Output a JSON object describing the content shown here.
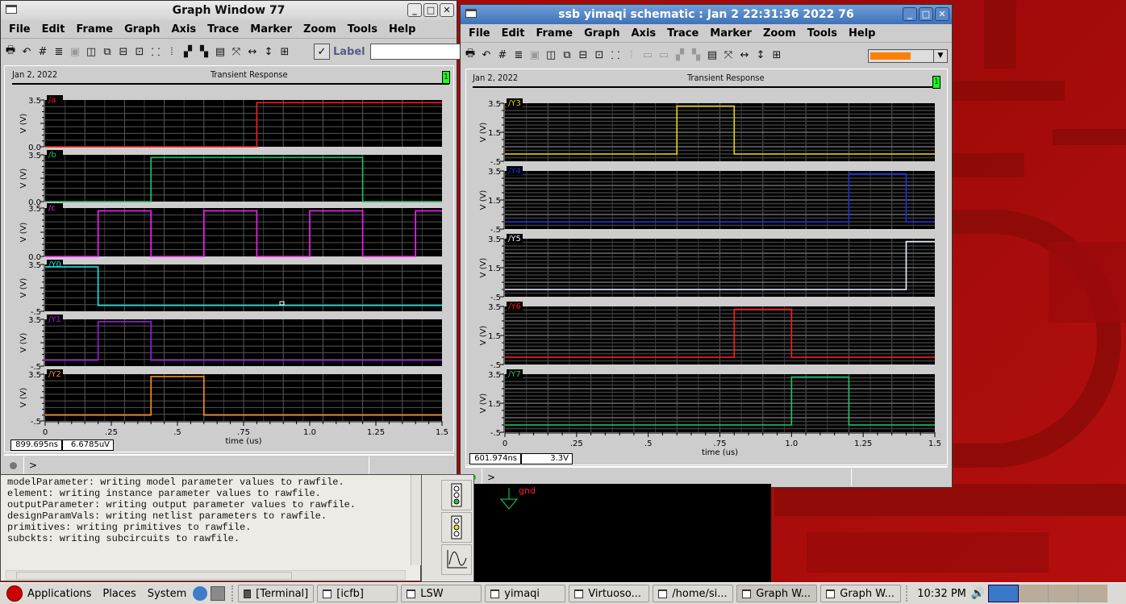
{
  "desktop": {
    "bg_color": "#a50b0b"
  },
  "window1": {
    "title": "Graph Window 77",
    "menu": [
      "File",
      "Edit",
      "Frame",
      "Graph",
      "Axis",
      "Trace",
      "Marker",
      "Zoom",
      "Tools",
      "Help"
    ],
    "toolbar_label_check": "Label",
    "label_input_value": "",
    "header_date": "Jan 2, 2022",
    "header_title": "Transient Response",
    "header_badge": "1",
    "readout_x": "899.695ns",
    "readout_y": "6.6785uV",
    "prompt": ">"
  },
  "window2": {
    "title": "ssb yimaqi schematic : Jan  2 22:31:36 2022 76",
    "menu": [
      "File",
      "Edit",
      "Frame",
      "Graph",
      "Axis",
      "Trace",
      "Marker",
      "Zoom",
      "Tools",
      "Help"
    ],
    "header_date": "Jan 2, 2022",
    "header_title": "Transient Response",
    "header_badge": "1",
    "readout_x": "601.974ns",
    "readout_y": "3.3V",
    "prompt": ">",
    "color_swatch": "#ff7f00"
  },
  "chart_data": [
    {
      "type": "line",
      "title": "Transient Response",
      "xlabel": "time (us)",
      "ylabel": "V (V)",
      "xlim": [
        0,
        1.5
      ],
      "x_ticks": [
        "0",
        ".25",
        ".5",
        ".75",
        "1.0",
        "1.25",
        "1.5"
      ],
      "series": [
        {
          "name": "/a",
          "color": "#ff1a1a",
          "ylim": [
            0,
            3.5
          ],
          "yticks": [
            "3.5",
            "0.0"
          ],
          "x": [
            0,
            0.8,
            0.8,
            1.5
          ],
          "y": [
            0,
            0,
            3.3,
            3.3
          ]
        },
        {
          "name": "/b",
          "color": "#19c46a",
          "ylim": [
            0,
            3.5
          ],
          "yticks": [
            "3.5",
            "0.0"
          ],
          "x": [
            0,
            0.4,
            0.4,
            1.2,
            1.2,
            1.5
          ],
          "y": [
            0,
            0,
            3.3,
            3.3,
            0,
            0
          ]
        },
        {
          "name": "/c",
          "color": "#ff1aff",
          "ylim": [
            0,
            3.5
          ],
          "yticks": [
            "3.5",
            "0.0"
          ],
          "x": [
            0,
            0.2,
            0.2,
            0.4,
            0.4,
            0.6,
            0.6,
            0.8,
            0.8,
            1.0,
            1.0,
            1.2,
            1.2,
            1.4,
            1.4,
            1.5
          ],
          "y": [
            0,
            0,
            3.3,
            3.3,
            0,
            0,
            3.3,
            3.3,
            0,
            0,
            3.3,
            3.3,
            0,
            0,
            3.3,
            3.3
          ]
        },
        {
          "name": "/Y0",
          "color": "#19e6e6",
          "ylim": [
            -0.5,
            3.5
          ],
          "yticks": [
            "3.5",
            "-.5"
          ],
          "x": [
            0,
            0.2,
            0.2,
            1.5
          ],
          "y": [
            3.3,
            3.3,
            0,
            0
          ]
        },
        {
          "name": "/Y1",
          "color": "#9a1ae0",
          "ylim": [
            -0.5,
            3.5
          ],
          "yticks": [
            "3.5",
            "-.5"
          ],
          "x": [
            0,
            0.2,
            0.2,
            0.4,
            0.4,
            1.5
          ],
          "y": [
            0,
            0,
            3.3,
            3.3,
            0,
            0
          ]
        },
        {
          "name": "/Y2",
          "color": "#ff8c1a",
          "ylim": [
            -0.5,
            3.5
          ],
          "yticks": [
            "3.5",
            "-.5"
          ],
          "x": [
            0,
            0.4,
            0.4,
            0.6,
            0.6,
            1.5
          ],
          "y": [
            0,
            0,
            3.3,
            3.3,
            0,
            0
          ]
        }
      ]
    },
    {
      "type": "line",
      "title": "Transient Response",
      "xlabel": "time (us)",
      "ylabel": "V (V)",
      "xlim": [
        0,
        1.5
      ],
      "x_ticks": [
        "0",
        ".25",
        ".5",
        ".75",
        "1.0",
        "1.25",
        "1.5"
      ],
      "series": [
        {
          "name": "/Y3",
          "color": "#e6d21a",
          "ylim": [
            -0.5,
            3.5
          ],
          "yticks": [
            "3.5",
            "1.5",
            "-.5"
          ],
          "x": [
            0,
            0.6,
            0.6,
            0.8,
            0.8,
            1.5
          ],
          "y": [
            0,
            0,
            3.3,
            3.3,
            0,
            0
          ]
        },
        {
          "name": "/Y4",
          "color": "#1a2ee6",
          "ylim": [
            -0.5,
            3.5
          ],
          "yticks": [
            "3.5",
            "1.5",
            "-.5"
          ],
          "x": [
            0,
            1.2,
            1.2,
            1.4,
            1.4,
            1.5
          ],
          "y": [
            0,
            0,
            3.3,
            3.3,
            0,
            0
          ]
        },
        {
          "name": "/Y5",
          "color": "#e8f0ff",
          "ylim": [
            -0.5,
            3.5
          ],
          "yticks": [
            "3.5",
            "1.5",
            "-.5"
          ],
          "x": [
            0,
            1.4,
            1.4,
            1.5
          ],
          "y": [
            0,
            0,
            3.3,
            3.3
          ]
        },
        {
          "name": "/Y6",
          "color": "#ff1a1a",
          "ylim": [
            -0.5,
            3.5
          ],
          "yticks": [
            "3.5",
            "1.5",
            "-.5"
          ],
          "x": [
            0,
            0.8,
            0.8,
            1.0,
            1.0,
            1.5
          ],
          "y": [
            0,
            0,
            3.3,
            3.3,
            0,
            0
          ]
        },
        {
          "name": "/Y7",
          "color": "#19c46a",
          "ylim": [
            -0.5,
            3.5
          ],
          "yticks": [
            "3.5",
            "1.5",
            "-.5"
          ],
          "x": [
            0,
            1.0,
            1.0,
            1.2,
            1.2,
            1.5
          ],
          "y": [
            0,
            0,
            3.3,
            3.3,
            0,
            0
          ]
        }
      ]
    }
  ],
  "terminal": {
    "lines": [
      "modelParameter: writing model parameter values to rawfile.",
      "element: writing instance parameter values to rawfile.",
      "outputParameter: writing output parameter values to rawfile.",
      "designParamVals: writing netlist parameters to rawfile.",
      "primitives: writing primitives to rawfile.",
      "subckts: writing subcircuits to rawfile."
    ]
  },
  "schematic": {
    "net_label": "gnd"
  },
  "taskbar": {
    "menus": [
      "Applications",
      "Places",
      "System"
    ],
    "tasks": [
      "[Terminal]",
      "[icfb]",
      "LSW",
      "yimaqi",
      "Virtuoso...",
      "/home/si...",
      "Graph W...",
      "Graph W..."
    ],
    "active_task_index": 6,
    "clock": "10:32 PM"
  }
}
